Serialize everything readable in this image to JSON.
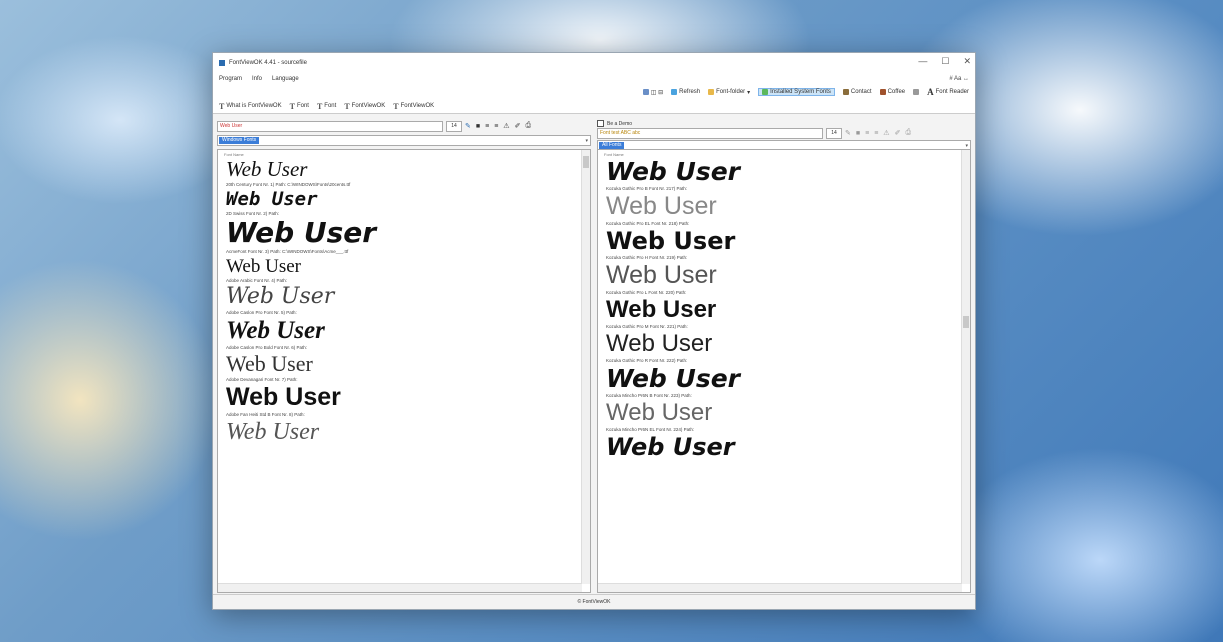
{
  "window": {
    "title": "FontViewOK 4.41 - sourcefile",
    "controls": [
      "—",
      "☐",
      "✕"
    ]
  },
  "menu": {
    "items": [
      "Program",
      "Info",
      "Language"
    ],
    "right_info": "# Aa  ↔"
  },
  "toolbar": {
    "buttons": [
      {
        "label": "◫ ⊟",
        "icon": "layout-icon"
      },
      {
        "label": "Refresh",
        "icon": "refresh-icon"
      },
      {
        "label": "Font-folder",
        "icon": "folder-icon"
      },
      {
        "label": "Installed System Fonts",
        "icon": "font-list-icon",
        "active": true
      },
      {
        "label": "Contact",
        "icon": "contact-icon"
      },
      {
        "label": "Coffee",
        "icon": "coffee-icon"
      },
      {
        "label": "",
        "icon": "info-icon"
      },
      {
        "label": "Font Reader",
        "icon": "font-reader-icon"
      }
    ]
  },
  "tabs": [
    "What is FontViewOK",
    "Font",
    "Font",
    "FontViewOK",
    "FontViewOK"
  ],
  "left_pane": {
    "text_input": "Web User",
    "size_button": "14",
    "combo_selected": "Windows Fonts",
    "list_header": "Font Name",
    "entries": [
      {
        "sample": "Web User",
        "caption": "20th Century Font Nr. 1) Path: C:\\WINDOWS\\Fonts\\20cents.ttf"
      },
      {
        "sample": "Web User",
        "caption": "2D Swiss Font Nr. 2) Path:"
      },
      {
        "sample": "Web User",
        "caption": "AcmeFont Font Nr. 3) Path: C:\\WINDOWS\\Fonts\\Acme___.ttf"
      },
      {
        "sample": "Web User",
        "caption": "Adobe Arabic Font Nr. 4) Path:"
      },
      {
        "sample": "Web User",
        "caption": "Adobe Caslon Pro Font Nr. 5) Path:"
      },
      {
        "sample": "Web User",
        "caption": "Adobe Caslon Pro Bold Font Nr. 6) Path:"
      },
      {
        "sample": "Web User",
        "caption": "Adobe Devanagari Font Nr. 7) Path:"
      },
      {
        "sample": "Web User",
        "caption": "Adobe Fan Heiti Std B Font Nr. 8) Path:"
      },
      {
        "sample": "Web User",
        "caption": ""
      }
    ]
  },
  "right_pane": {
    "checkbox_label": "Be a Demo",
    "text_input": "Font test ABC abc",
    "size_button": "14",
    "combo_selected": "All Fonts",
    "list_header": "Font Name",
    "entries": [
      {
        "sample": "Web User",
        "caption": "Kozuka Gothic Pro B Font Nr. 217) Path:"
      },
      {
        "sample": "Web User",
        "caption": "Kozuka Gothic Pro EL Font Nr. 218) Path:"
      },
      {
        "sample": "Web User",
        "caption": "Kozuka Gothic Pro H Font Nr. 219) Path:"
      },
      {
        "sample": "Web User",
        "caption": "Kozuka Gothic Pro L Font Nr. 220) Path:"
      },
      {
        "sample": "Web User",
        "caption": "Kozuka Gothic Pro M Font Nr. 221) Path:"
      },
      {
        "sample": "Web User",
        "caption": "Kozuka Gothic Pro R Font Nr. 222) Path:"
      },
      {
        "sample": "Web User",
        "caption": "Kozuka Mincho Pr6N B Font Nr. 223) Path:"
      },
      {
        "sample": "Web User",
        "caption": "Kozuka Mincho Pr6N EL Font Nr. 224) Path:"
      },
      {
        "sample": "Web User",
        "caption": ""
      }
    ]
  },
  "status": {
    "label": "© FontViewOK"
  }
}
